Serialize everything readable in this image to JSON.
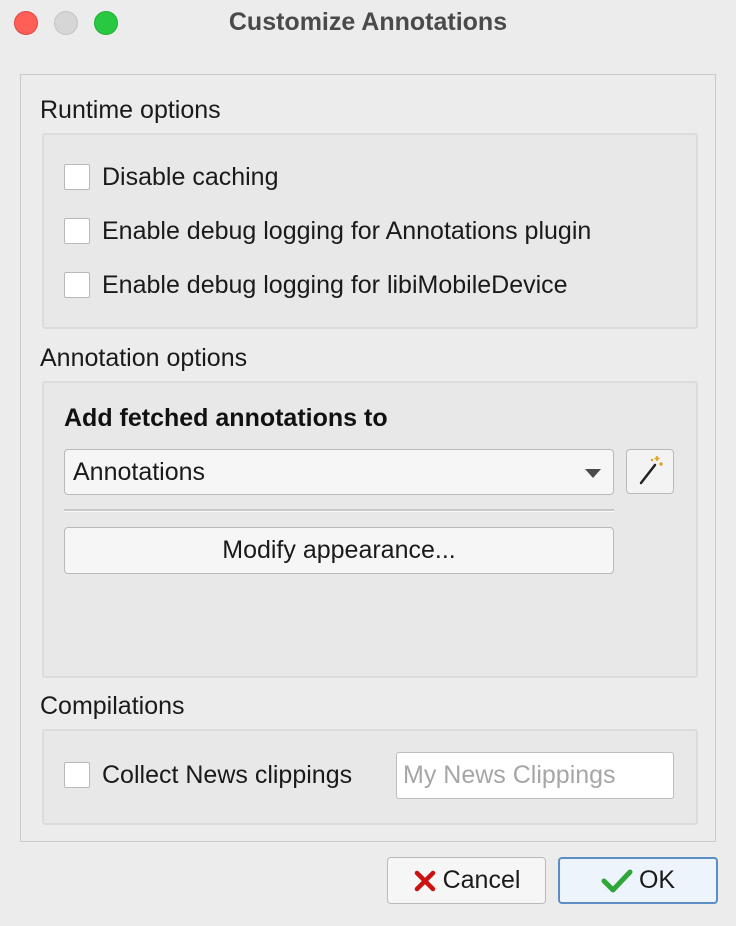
{
  "window": {
    "title": "Customize Annotations"
  },
  "runtime": {
    "heading": "Runtime options",
    "options": [
      {
        "label": "Disable caching",
        "checked": false
      },
      {
        "label": "Enable debug logging for Annotations plugin",
        "checked": false
      },
      {
        "label": "Enable debug logging for libiMobileDevice",
        "checked": false
      }
    ]
  },
  "annotation": {
    "heading": "Annotation options",
    "fetched_label": "Add fetched annotations to",
    "selected_value": "Annotations",
    "modify_button": "Modify appearance..."
  },
  "compilations": {
    "heading": "Compilations",
    "collect_label": "Collect News clippings",
    "collect_checked": false,
    "input_placeholder": "My News Clippings"
  },
  "buttons": {
    "cancel": "Cancel",
    "ok": "OK"
  },
  "colors": {
    "cancel_icon": "#cc1111",
    "ok_icon": "#2ea63a",
    "ok_border": "#5a8ec4"
  },
  "icons": {
    "cancel": "x-icon",
    "ok": "checkmark-icon",
    "wand": "magic-wand-icon"
  }
}
